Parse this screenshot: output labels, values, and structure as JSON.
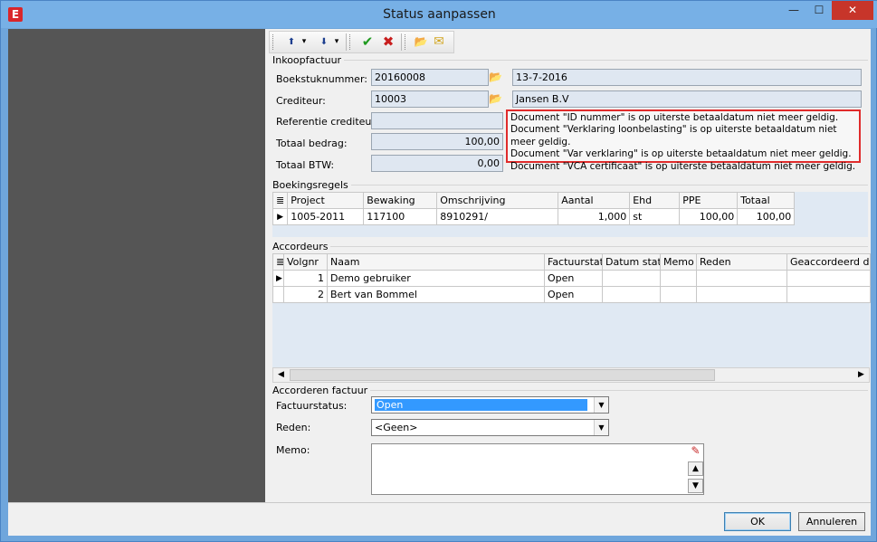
{
  "window": {
    "title": "Status aanpassen",
    "app_icon": "E",
    "close_glyph": "✕"
  },
  "toolbar": {
    "up": "⬆",
    "down": "⬇",
    "dropdown": "▾",
    "confirm": "✔",
    "cancel": "✖",
    "folder": "📂",
    "mail": "✉"
  },
  "inkoopfactuur": {
    "section": "Inkoopfactuur",
    "boekstuk_label": "Boekstuknummer:",
    "boekstuk_value": "20160008",
    "datum": "13-7-2016",
    "crediteur_label": "Crediteur:",
    "crediteur_value": "10003",
    "crediteur_naam": "Jansen B.V",
    "referentie_label": "Referentie crediteur:",
    "referentie_value": "",
    "totaal_label": "Totaal bedrag:",
    "totaal_value": "100,00",
    "btw_label": "Totaal BTW:",
    "btw_value": "0,00",
    "alerts": [
      "Document \"ID nummer\" is op uiterste betaaldatum niet meer geldig.",
      "Document \"Verklaring loonbelasting\" is op uiterste betaaldatum niet meer geldig.",
      "Document \"Var verklaring\" is op uiterste betaaldatum niet meer geldig.",
      "Document \"VCA certificaat\" is op uiterste betaaldatum niet meer geldig."
    ]
  },
  "boekingsregels": {
    "section": "Boekingsregels",
    "columns": [
      "Project",
      "Bewaking",
      "Omschrijving",
      "Aantal",
      "Ehd",
      "PPE",
      "Totaal"
    ],
    "rows": [
      [
        "1005-2011",
        "117100",
        "8910291/",
        "1,000",
        "st",
        "100,00",
        "100,00"
      ]
    ]
  },
  "accordeurs": {
    "section": "Accordeurs",
    "columns": [
      "Volgnr",
      "Naam",
      "Factuurstatu",
      "Datum statu",
      "Memo",
      "Reden",
      "Geaccordeerd door"
    ],
    "rows": [
      [
        "1",
        "Demo gebruiker",
        "Open",
        "",
        "",
        "",
        ""
      ],
      [
        "2",
        "Bert van Bommel",
        "Open",
        "",
        "",
        "",
        ""
      ]
    ]
  },
  "accorderen": {
    "section": "Accorderen factuur",
    "status_label": "Factuurstatus:",
    "status_value": "Open",
    "reden_label": "Reden:",
    "reden_value": "<Geen>",
    "memo_label": "Memo:",
    "memo_value": ""
  },
  "buttons": {
    "ok": "OK",
    "cancel": "Annuleren"
  }
}
